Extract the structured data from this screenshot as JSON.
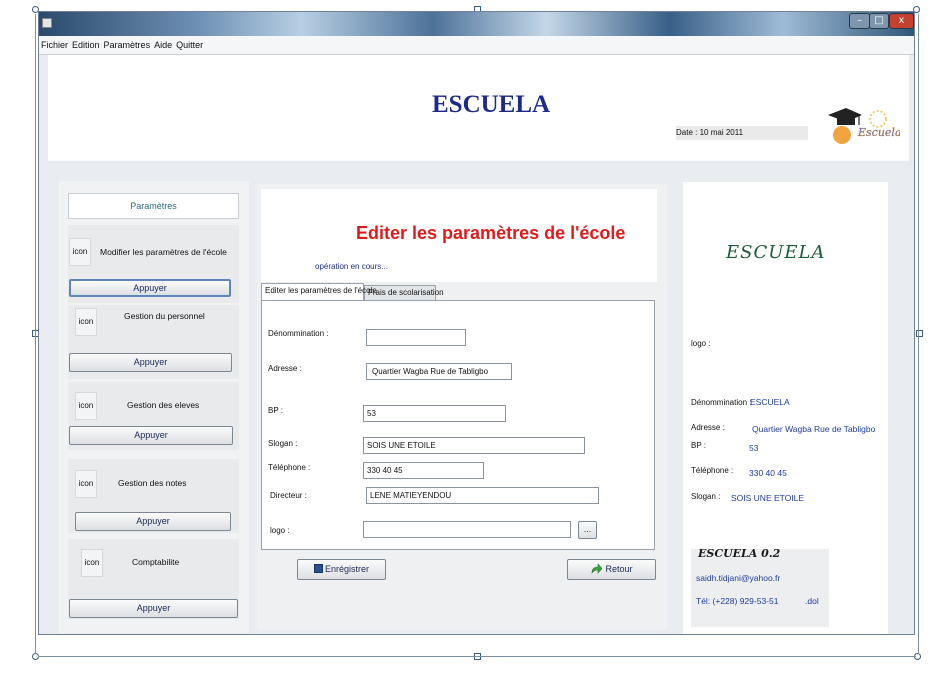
{
  "menu": [
    "Fichier",
    "Edition",
    "Paramètres",
    "Aide",
    "Quitter"
  ],
  "header": {
    "title": "ESCUELA",
    "date_label": "Date :",
    "date_value": "10 mai 2011",
    "logo_text": "Escuela"
  },
  "sidebar": {
    "title": "Paramètres",
    "items": [
      {
        "icon": "icon",
        "label": "Modifier les paramètres de l'école",
        "button": "Appuyer"
      },
      {
        "icon": "icon",
        "label": "Gestion du personnel",
        "button": "Appuyer"
      },
      {
        "icon": "icon",
        "label": "Gestion des eleves",
        "button": "Appuyer"
      },
      {
        "icon": "icon",
        "label": "Gestion des notes",
        "button": "Appuyer"
      },
      {
        "icon": "icon",
        "label": "Comptabilite",
        "button": "Appuyer"
      }
    ]
  },
  "form": {
    "heading": "Editer les paramètres de l'école",
    "status": "opération en cours...",
    "tabs": [
      "Editer les paramètres de l'école",
      "Frais de scolarisation"
    ],
    "fields": {
      "denomination": {
        "label": "Dénommination :",
        "value": ""
      },
      "adresse": {
        "label": "Adresse :",
        "value": "Quartier  Wagba    Rue de Tabligbo"
      },
      "bp": {
        "label": "BP  :",
        "value": "53"
      },
      "slogan": {
        "label": "Slogan :",
        "value": "SOIS UNE ETOILE"
      },
      "telephone": {
        "label": "Téléphone :",
        "value": "330 40 45"
      },
      "directeur": {
        "label": "Directeur :",
        "value": "LENE MATIEYENDOU"
      },
      "logo": {
        "label": "logo :",
        "value": ""
      }
    },
    "browse_label": "...",
    "save_label": "Enrégistrer",
    "back_label": "Retour"
  },
  "info": {
    "title": "ESCUELA",
    "logo_label": "logo :",
    "denomination_label": "Dénommination :",
    "denomination_value": "ESCUELA",
    "adresse_label": "Adresse :",
    "adresse_value": "Quartier  Wagba    Rue de Tabligbo",
    "bp_label": "BP :",
    "bp_value": "53",
    "telephone_label": "Téléphone :",
    "telephone_value": "330 40 45",
    "slogan_label": "Slogan :",
    "slogan_value": "SOIS UNE ETOILE",
    "credits_title": "ESCUELA 0.2",
    "email": "saidh.tidjani@yahoo.fr",
    "phone": "Tél: (+228) 929-53-51",
    "suffix": ".dol"
  },
  "colors": {
    "accent_red": "#e01b1b",
    "title_navy": "#1d2a8a",
    "link_blue": "#1f3c9e"
  }
}
